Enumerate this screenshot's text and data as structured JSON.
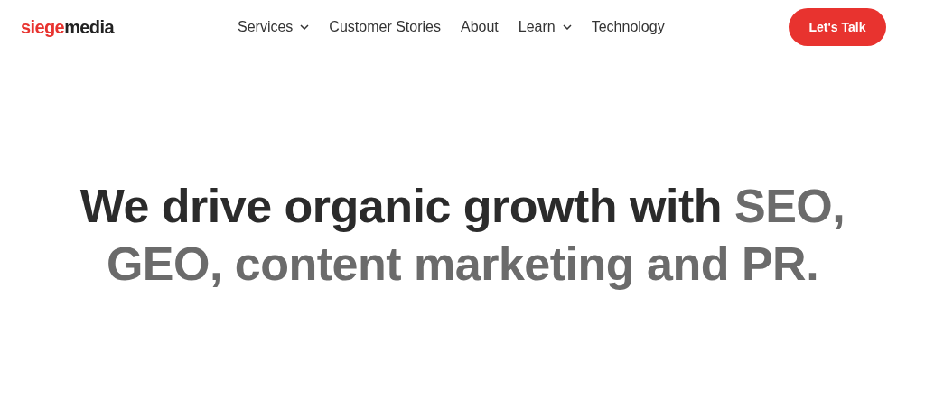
{
  "logo": {
    "accent": "siege",
    "rest": "media"
  },
  "nav": [
    {
      "label": "Services",
      "dropdown": true
    },
    {
      "label": "Customer Stories",
      "dropdown": false
    },
    {
      "label": "About",
      "dropdown": false
    },
    {
      "label": "Learn",
      "dropdown": true
    },
    {
      "label": "Technology",
      "dropdown": false
    }
  ],
  "cta": "Let's Talk",
  "headline": {
    "lead": "We drive organic growth with ",
    "rest": "SEO, GEO, content marketing and PR."
  }
}
